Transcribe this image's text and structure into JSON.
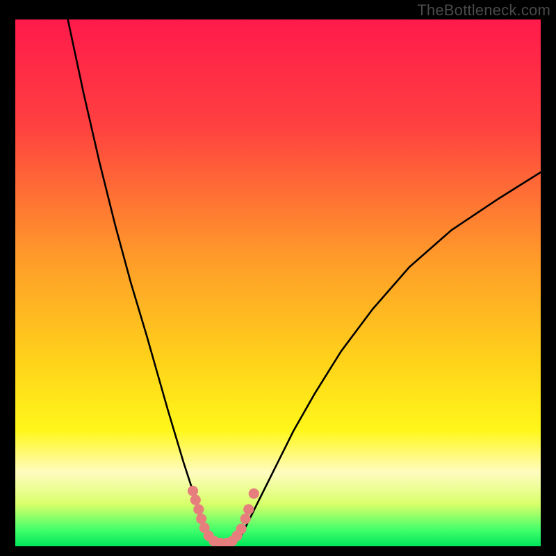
{
  "watermark": "TheBottleneck.com",
  "chart_data": {
    "type": "line",
    "title": "",
    "xlabel": "",
    "ylabel": "",
    "xlim": [
      0,
      100
    ],
    "ylim": [
      0,
      100
    ],
    "grid": false,
    "legend": false,
    "background_gradient": {
      "stops": [
        {
          "offset": 0.0,
          "color": "#ff1a4b"
        },
        {
          "offset": 0.2,
          "color": "#ff4040"
        },
        {
          "offset": 0.45,
          "color": "#ff9a2a"
        },
        {
          "offset": 0.65,
          "color": "#ffd31a"
        },
        {
          "offset": 0.78,
          "color": "#fff71a"
        },
        {
          "offset": 0.86,
          "color": "#fffcc0"
        },
        {
          "offset": 0.92,
          "color": "#d9ff6a"
        },
        {
          "offset": 0.97,
          "color": "#3fff6a"
        },
        {
          "offset": 1.0,
          "color": "#00e55a"
        }
      ]
    },
    "series": [
      {
        "name": "left-branch",
        "x": [
          10.0,
          13.0,
          16.0,
          19.0,
          22.0,
          25.0,
          27.0,
          29.0,
          30.5,
          32.0,
          33.3,
          34.3,
          35.0,
          35.8,
          36.5
        ],
        "y": [
          100.0,
          86.0,
          73.0,
          61.0,
          50.0,
          40.0,
          33.0,
          26.0,
          21.0,
          16.0,
          12.0,
          9.0,
          6.5,
          4.0,
          2.0
        ]
      },
      {
        "name": "right-branch",
        "x": [
          43.0,
          44.0,
          45.5,
          47.5,
          50.0,
          53.0,
          57.0,
          62.0,
          68.0,
          75.0,
          83.0,
          92.0,
          100.0
        ],
        "y": [
          2.0,
          4.0,
          7.0,
          11.0,
          16.0,
          22.0,
          29.0,
          37.0,
          45.0,
          53.0,
          60.0,
          66.0,
          71.0
        ]
      },
      {
        "name": "trough",
        "x": [
          36.5,
          37.5,
          38.5,
          39.5,
          40.5,
          41.5,
          43.0
        ],
        "y": [
          2.0,
          1.0,
          0.6,
          0.5,
          0.6,
          1.0,
          2.0
        ]
      }
    ],
    "markers": {
      "name": "trough-trace",
      "color": "#e77e7e",
      "radius_pct": 1.0,
      "points": [
        {
          "x": 33.8,
          "y": 10.5
        },
        {
          "x": 34.3,
          "y": 8.8
        },
        {
          "x": 34.9,
          "y": 7.0
        },
        {
          "x": 35.4,
          "y": 5.2
        },
        {
          "x": 36.0,
          "y": 3.5
        },
        {
          "x": 36.8,
          "y": 2.0
        },
        {
          "x": 37.8,
          "y": 1.0
        },
        {
          "x": 39.0,
          "y": 0.6
        },
        {
          "x": 40.2,
          "y": 0.6
        },
        {
          "x": 41.3,
          "y": 1.0
        },
        {
          "x": 42.2,
          "y": 2.0
        },
        {
          "x": 43.0,
          "y": 3.3
        },
        {
          "x": 43.8,
          "y": 5.2
        },
        {
          "x": 44.4,
          "y": 7.0
        },
        {
          "x": 45.4,
          "y": 10.0
        }
      ]
    }
  }
}
